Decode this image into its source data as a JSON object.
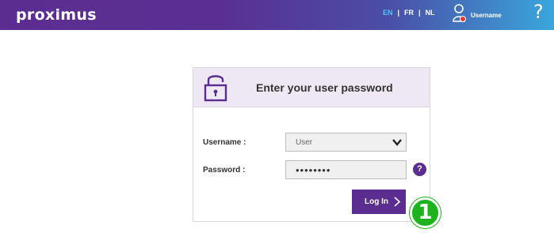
{
  "header": {
    "logo": "proximus",
    "languages": [
      {
        "code": "EN",
        "active": true
      },
      {
        "code": "FR",
        "active": false
      },
      {
        "code": "NL",
        "active": false
      }
    ],
    "separator": "|",
    "user_label": "Username",
    "help_glyph": "?",
    "colors": {
      "primary": "#5c2d91",
      "accent": "#3aa6dc",
      "active_lang": "#4fc3f7"
    }
  },
  "login_card": {
    "title": "Enter your user password",
    "icon": "lock-icon",
    "username_label": "Username :",
    "username_value": "User",
    "password_label": "Password :",
    "password_value": "••••••••",
    "help_glyph": "?",
    "submit_label": "Log In"
  },
  "annotation": {
    "step_number": "1",
    "color": "#1db31d"
  }
}
